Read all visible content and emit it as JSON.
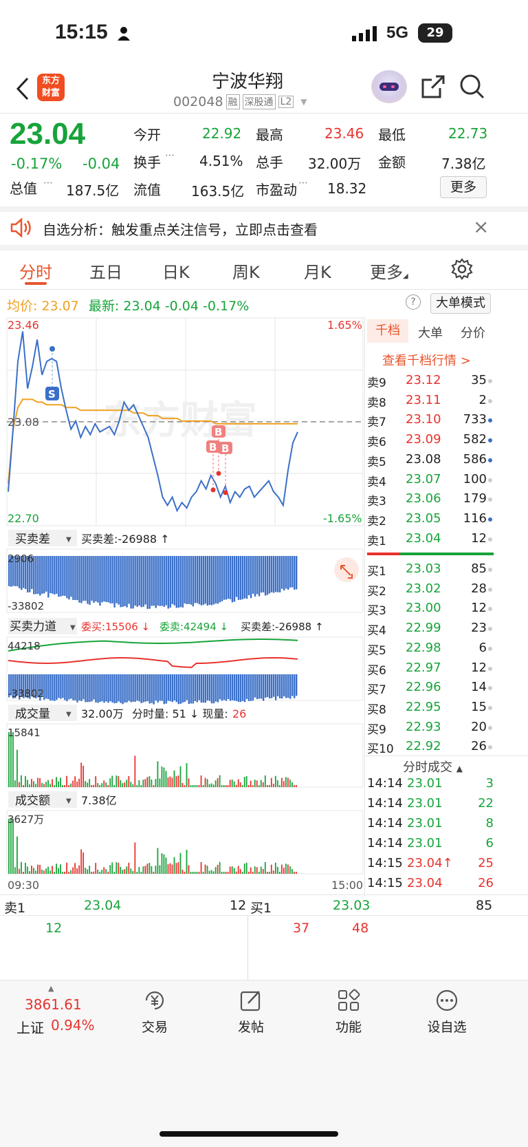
{
  "status": {
    "time": "15:15",
    "net": "5G",
    "battery": "29"
  },
  "header": {
    "logo": "东方\n财富",
    "title": "宁波华翔",
    "code": "002048",
    "badges": [
      "融",
      "深股通",
      "L2"
    ]
  },
  "quote": {
    "price": "23.04",
    "pct": "-0.17%",
    "chg": "-0.04",
    "stats": [
      {
        "l": "今开",
        "v": "22.92",
        "c": "green"
      },
      {
        "l": "最高",
        "v": "23.46",
        "c": "red"
      },
      {
        "l": "最低",
        "v": "22.73",
        "c": "green"
      },
      {
        "l": "换手",
        "v": "4.51%",
        "c": ""
      },
      {
        "l": "总手",
        "v": "32.00万",
        "c": ""
      },
      {
        "l": "金额",
        "v": "7.38亿",
        "c": ""
      },
      {
        "l": "总值",
        "v": "187.5亿",
        "c": ""
      },
      {
        "l": "流值",
        "v": "163.5亿",
        "c": ""
      },
      {
        "l": "市盈动",
        "v": "18.32",
        "c": ""
      }
    ],
    "more": "更多"
  },
  "notice": {
    "text": "自选分析：触发重点关注信号，立即点击查看",
    "close": "×"
  },
  "tabs": {
    "items": [
      "分时",
      "五日",
      "日K",
      "周K",
      "月K",
      "更多"
    ],
    "active": 0
  },
  "info": {
    "avg_label": "均价:",
    "avg": "23.07",
    "last_label": "最新:",
    "last": "23.04",
    "chg": "-0.04",
    "pct": "-0.17%",
    "mode": "大单模式"
  },
  "chart": {
    "high": "23.46",
    "low": "22.70",
    "mid": "23.08",
    "up_pct": "1.65%",
    "down_pct": "-1.65%",
    "t0": "09:30",
    "t1": "15:00",
    "watermark": "东方财富"
  },
  "chart_data": {
    "type": "line",
    "x_range": [
      "09:30",
      "14:15"
    ],
    "ylim": [
      22.7,
      23.46
    ],
    "prev_close": 23.08,
    "series": [
      {
        "name": "最新",
        "color": "#3a6fc8",
        "values": [
          22.82,
          23.05,
          23.3,
          23.41,
          23.2,
          23.28,
          23.38,
          23.25,
          23.3,
          23.31,
          23.3,
          23.2,
          23.12,
          23.05,
          23.08,
          23.02,
          23.06,
          23.03,
          23.07,
          23.04,
          23.05,
          23.06,
          23.03,
          23.08,
          23.15,
          23.12,
          23.14,
          23.1,
          23.06,
          23.02,
          22.95,
          22.88,
          22.8,
          22.77,
          22.8,
          22.75,
          22.78,
          22.76,
          22.8,
          22.82,
          22.86,
          22.83,
          22.88,
          22.85,
          22.8,
          22.84,
          22.78,
          22.82,
          22.8,
          22.83,
          22.84,
          22.8,
          22.82,
          22.84,
          22.86,
          22.82,
          22.8,
          22.77,
          22.9,
          23.0,
          23.04
        ]
      },
      {
        "name": "均价",
        "color": "#f0a020",
        "values": [
          22.85,
          23.05,
          23.13,
          23.16,
          23.16,
          23.16,
          23.15,
          23.15,
          23.14,
          23.14,
          23.14,
          23.14,
          23.13,
          23.13,
          23.13,
          23.12,
          23.12,
          23.12,
          23.12,
          23.12,
          23.12,
          23.12,
          23.12,
          23.12,
          23.12,
          23.12,
          23.11,
          23.11,
          23.11,
          23.1,
          23.1,
          23.1,
          23.09,
          23.09,
          23.09,
          23.09,
          23.08,
          23.08,
          23.08,
          23.08,
          23.08,
          23.08,
          23.08,
          23.07,
          23.07,
          23.07,
          23.07,
          23.07,
          23.07,
          23.07,
          23.07,
          23.07,
          23.07,
          23.07,
          23.07,
          23.07,
          23.07,
          23.07,
          23.07,
          23.07,
          23.07
        ]
      }
    ],
    "signals": [
      "S",
      "B",
      "B",
      "B"
    ],
    "sub_charts": [
      {
        "name": "买卖差",
        "label": "买卖差:-26988 ↑",
        "top": "2906",
        "bottom": "-33802"
      },
      {
        "name": "买卖力道",
        "label_buy": "委买:15506 ↓",
        "label_sell": "委卖:42494 ↓",
        "label_diff": "买卖差:-26988 ↑",
        "top": "44218",
        "bottom": "-33802"
      },
      {
        "name": "成交量",
        "label": "32.00万",
        "label2": "分时量: 51 ↓ 现量:",
        "label2_val": "26",
        "top": "15841"
      },
      {
        "name": "成交额",
        "label": "7.38亿",
        "top": "3627万"
      }
    ]
  },
  "book": {
    "tabs": [
      "千档",
      "大单",
      "分价"
    ],
    "link": "查看千档行情 >",
    "asks": [
      {
        "l": "卖9",
        "p": "23.12",
        "v": "35",
        "c": "red"
      },
      {
        "l": "卖8",
        "p": "23.11",
        "v": "2",
        "c": "red"
      },
      {
        "l": "卖7",
        "p": "23.10",
        "v": "733",
        "c": "red"
      },
      {
        "l": "卖6",
        "p": "23.09",
        "v": "582",
        "c": "red"
      },
      {
        "l": "卖5",
        "p": "23.08",
        "v": "586",
        "c": ""
      },
      {
        "l": "卖4",
        "p": "23.07",
        "v": "100",
        "c": "green"
      },
      {
        "l": "卖3",
        "p": "23.06",
        "v": "179",
        "c": "green"
      },
      {
        "l": "卖2",
        "p": "23.05",
        "v": "116",
        "c": "green"
      },
      {
        "l": "卖1",
        "p": "23.04",
        "v": "12",
        "c": "green"
      }
    ],
    "bids": [
      {
        "l": "买1",
        "p": "23.03",
        "v": "85",
        "c": "green"
      },
      {
        "l": "买2",
        "p": "23.02",
        "v": "28",
        "c": "green"
      },
      {
        "l": "买3",
        "p": "23.00",
        "v": "12",
        "c": "green"
      },
      {
        "l": "买4",
        "p": "22.99",
        "v": "23",
        "c": "green"
      },
      {
        "l": "买5",
        "p": "22.98",
        "v": "6",
        "c": "green"
      },
      {
        "l": "买6",
        "p": "22.97",
        "v": "12",
        "c": "green"
      },
      {
        "l": "买7",
        "p": "22.96",
        "v": "14",
        "c": "green"
      },
      {
        "l": "买8",
        "p": "22.95",
        "v": "15",
        "c": "green"
      },
      {
        "l": "买9",
        "p": "22.93",
        "v": "20",
        "c": "green"
      },
      {
        "l": "买10",
        "p": "22.92",
        "v": "26",
        "c": "green"
      }
    ],
    "ticks_title": "分时成交",
    "ticks": [
      {
        "t": "14:14",
        "p": "23.01",
        "v": "3",
        "c": "green"
      },
      {
        "t": "14:14",
        "p": "23.01",
        "v": "22",
        "c": "green"
      },
      {
        "t": "14:14",
        "p": "23.01",
        "v": "8",
        "c": "green"
      },
      {
        "t": "14:14",
        "p": "23.01",
        "v": "6",
        "c": "green"
      },
      {
        "t": "14:15",
        "p": "23.04↑",
        "v": "25",
        "c": "red"
      },
      {
        "t": "14:15",
        "p": "23.04",
        "v": "26",
        "c": "red"
      }
    ]
  },
  "queue": {
    "ask_label": "卖1",
    "ask_price": "23.04",
    "ask_vol": "12",
    "bid_label": "买1",
    "bid_price": "23.03",
    "bid_vol": "85",
    "ask_orders": [
      "12"
    ],
    "bid_orders": [
      "37",
      "48"
    ]
  },
  "bottom": {
    "index": "3861.61",
    "index_name": "上证",
    "index_pct": "0.94%",
    "items": [
      "交易",
      "发帖",
      "功能",
      "设自选"
    ]
  }
}
